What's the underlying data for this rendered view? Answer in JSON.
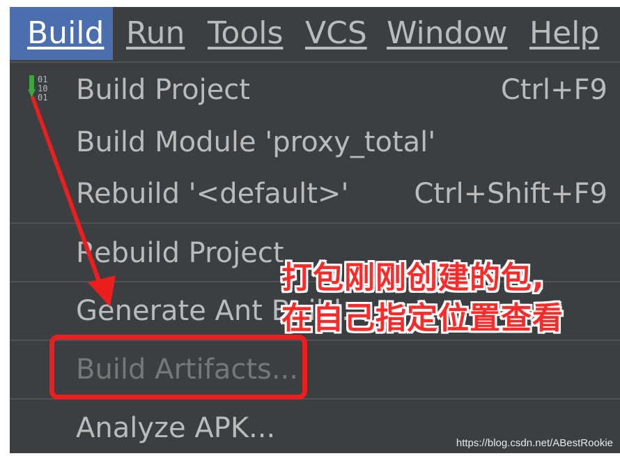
{
  "menubar": {
    "items": [
      {
        "label": "Build",
        "active": true
      },
      {
        "label": "Run"
      },
      {
        "label": "Tools"
      },
      {
        "label": "VCS"
      },
      {
        "label": "Window"
      },
      {
        "label": "Help"
      }
    ]
  },
  "dropdown": {
    "build_icon_glyph": "01\n10\n01",
    "items": [
      {
        "label": "Build Project",
        "shortcut": "Ctrl+F9"
      },
      {
        "label": "Build Module 'proxy_total'"
      },
      {
        "label": "Rebuild '<default>'",
        "shortcut": "Ctrl+Shift+F9"
      },
      {
        "label": "Rebuild Project"
      },
      {
        "label": "Generate Ant Build..."
      },
      {
        "label": "Build Artifacts...",
        "disabled": true
      },
      {
        "label": "Analyze APK..."
      }
    ]
  },
  "annotation": {
    "line1": "打包刚刚创建的包,",
    "line2": "在自己指定位置查看"
  },
  "watermark": "https://blog.csdn.net/ABestRookie",
  "colors": {
    "menu_bg": "#3c3f41",
    "active_menu": "#4b6eaf",
    "text": "#bbbbbb",
    "disabled_text": "#777777",
    "annotation_red": "#ee1e1e",
    "icon_green": "#3fa63f"
  }
}
